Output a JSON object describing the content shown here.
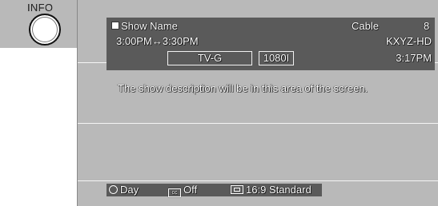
{
  "info_button": {
    "label": "INFO"
  },
  "banner": {
    "show_name": "Show Name",
    "source": "Cable",
    "channel": "8",
    "time_range": "3:00PM↔3:30PM",
    "call_sign": "KXYZ-HD",
    "rating": "TV-G",
    "resolution": "1080I",
    "clock": "3:17PM"
  },
  "description": "The show description will be in this area of the screen.",
  "bottom_bar": {
    "sleep_label": "Day",
    "caption_label": "Off",
    "aspect_label": "16:9 Standard"
  },
  "icons": {
    "square_icon": "filled-square",
    "clock_icon": "clock",
    "caption_icon": "closed-caption",
    "aspect_icon": "aspect-ratio"
  }
}
